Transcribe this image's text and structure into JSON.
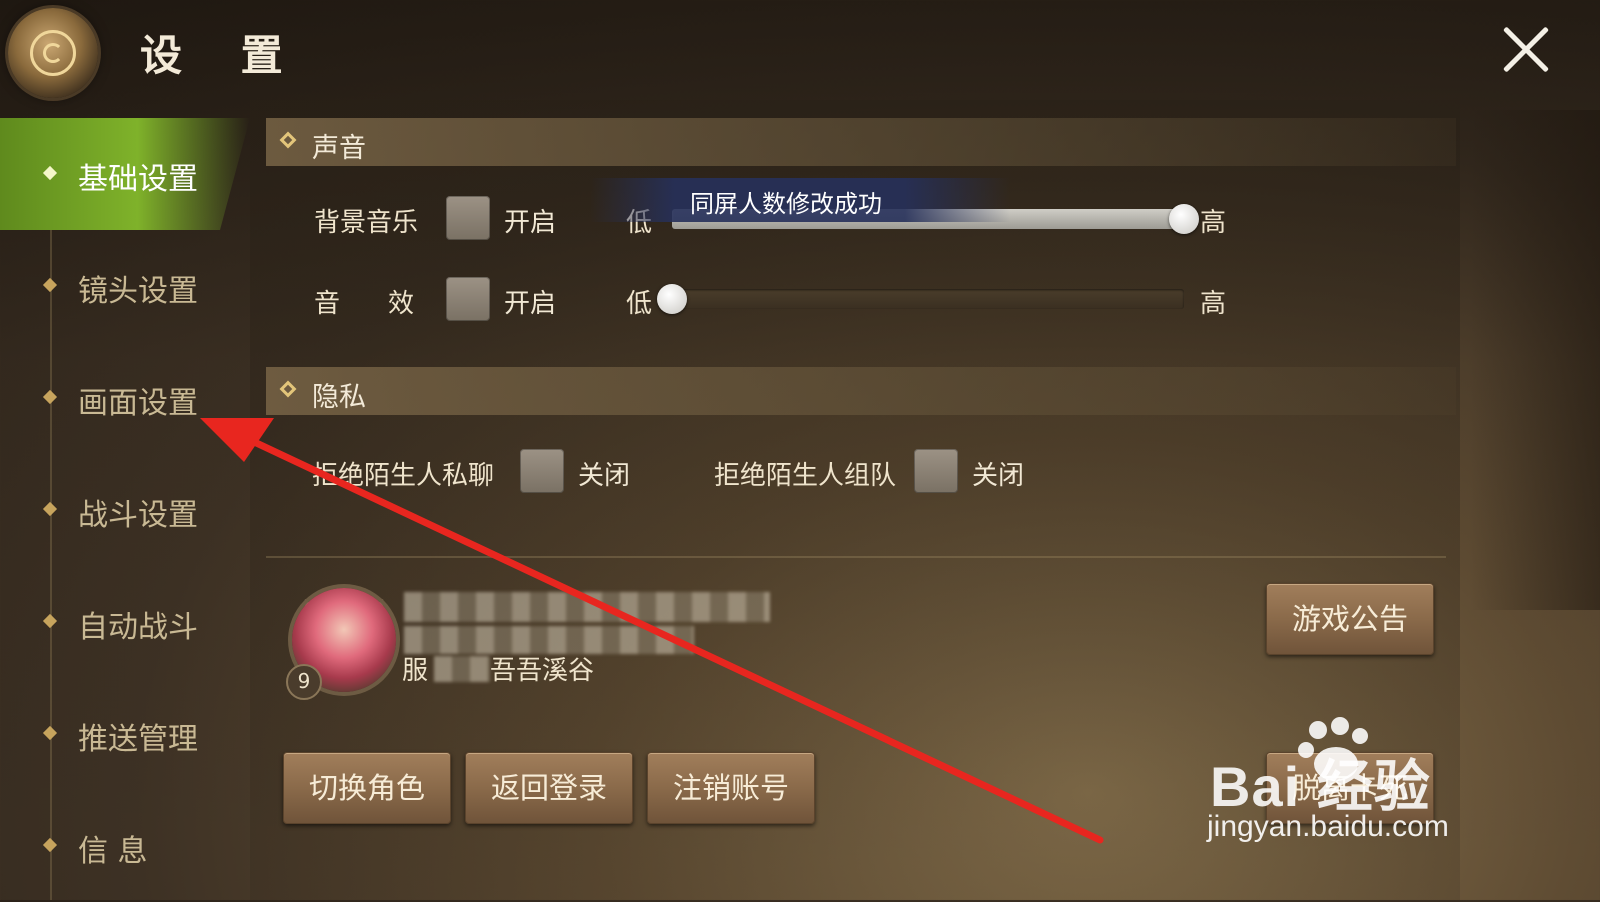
{
  "header": {
    "title": "设 置"
  },
  "sidebar": {
    "items": [
      {
        "label": "基础设置",
        "active": true
      },
      {
        "label": "镜头设置",
        "active": false
      },
      {
        "label": "画面设置",
        "active": false
      },
      {
        "label": "战斗设置",
        "active": false
      },
      {
        "label": "自动战斗",
        "active": false
      },
      {
        "label": "推送管理",
        "active": false
      },
      {
        "label": "信 息",
        "active": false
      }
    ]
  },
  "sound": {
    "section_title": "声音",
    "bgm": {
      "label": "背景音乐",
      "toggle_label": "开启",
      "low_label": "低",
      "high_label": "高",
      "level": 1.0
    },
    "sfx": {
      "label_a": "音",
      "label_b": "效",
      "toggle_label": "开启",
      "low_label": "低",
      "high_label": "高",
      "level": 0.0
    }
  },
  "toast": {
    "message": "同屏人数修改成功"
  },
  "privacy": {
    "section_title": "隐私",
    "reject_chat": {
      "label": "拒绝陌生人私聊",
      "toggle_label": "关闭"
    },
    "reject_team": {
      "label": "拒绝陌生人组队",
      "toggle_label": "关闭"
    }
  },
  "profile": {
    "level": "9",
    "server_prefix": "服",
    "server_suffix": "吾吾溪谷"
  },
  "buttons": {
    "announcement": "游戏公告",
    "switch_role": "切换角色",
    "back_login": "返回登录",
    "logout_account": "注销账号",
    "unstuck": "脱离卡死"
  },
  "watermark": {
    "brand": "Bai  经验",
    "url": "jingyan.baidu.com"
  },
  "colors": {
    "active_tab": "#7fb22a",
    "annotation_arrow": "#e8261f",
    "button_brown": "#8a6a4a"
  }
}
